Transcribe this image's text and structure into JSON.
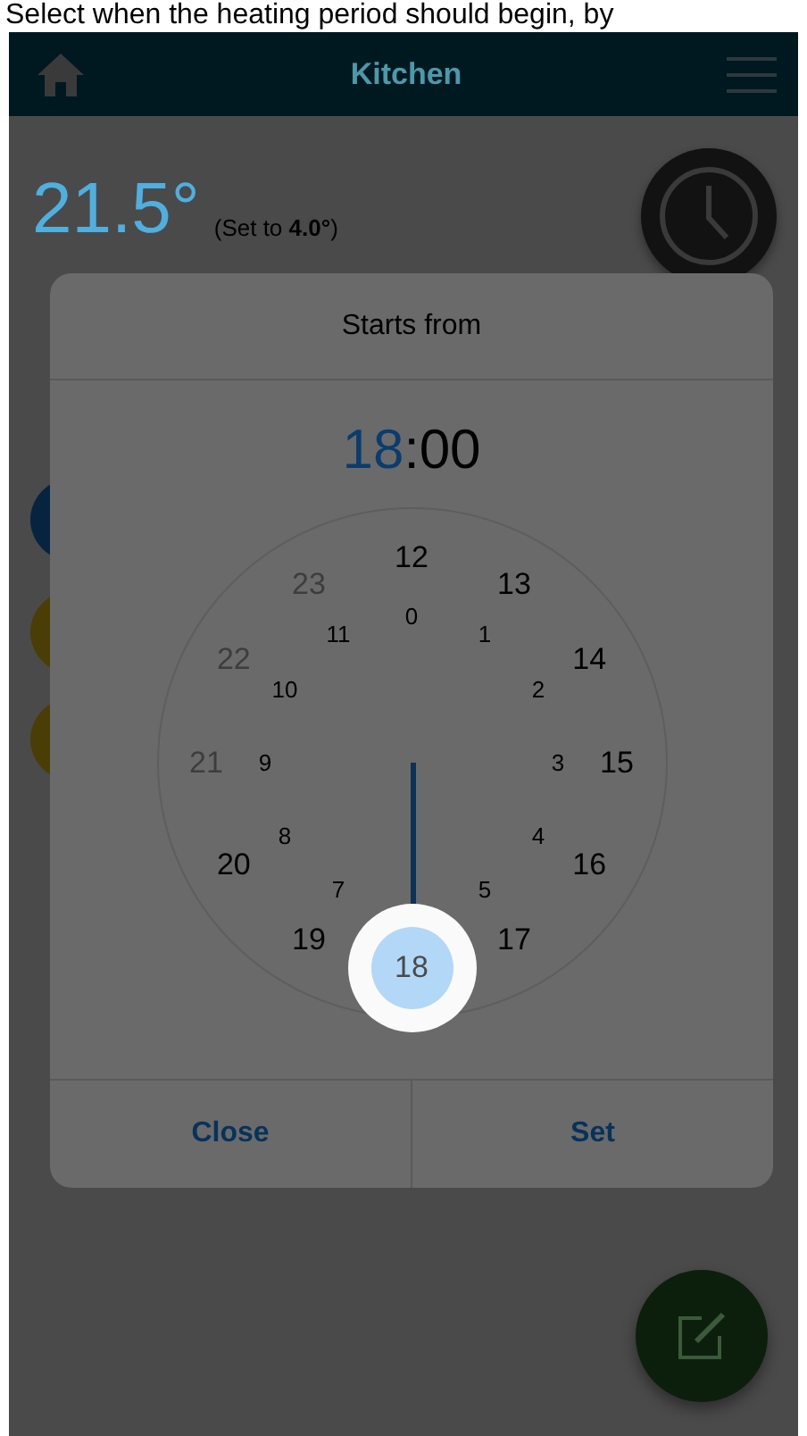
{
  "caption": "Select when the heating period should begin, by",
  "header": {
    "title": "Kitchen"
  },
  "room": {
    "temperature": "21.5°",
    "setpoint": "(Set to **4.0°**)"
  },
  "dialog": {
    "title": "Starts from",
    "time": {
      "hour": "18",
      "separator": ":",
      "minute": "00",
      "hour_selected": true
    },
    "outer_hours": [
      {
        "label": "12",
        "selected": false,
        "disabled": false
      },
      {
        "label": "13",
        "selected": false,
        "disabled": false
      },
      {
        "label": "14",
        "selected": false,
        "disabled": false
      },
      {
        "label": "15",
        "selected": false,
        "disabled": false
      },
      {
        "label": "16",
        "selected": false,
        "disabled": false
      },
      {
        "label": "17",
        "selected": false,
        "disabled": false
      },
      {
        "label": "18",
        "selected": true,
        "disabled": false
      },
      {
        "label": "19",
        "selected": false,
        "disabled": false
      },
      {
        "label": "20",
        "selected": false,
        "disabled": false
      },
      {
        "label": "21",
        "selected": false,
        "disabled": true
      },
      {
        "label": "22",
        "selected": false,
        "disabled": true
      },
      {
        "label": "23",
        "selected": false,
        "disabled": true
      }
    ],
    "inner_hours": [
      {
        "label": "0",
        "selected": false,
        "disabled": false
      },
      {
        "label": "1",
        "selected": false,
        "disabled": false
      },
      {
        "label": "2",
        "selected": false,
        "disabled": false
      },
      {
        "label": "3",
        "selected": false,
        "disabled": false
      },
      {
        "label": "4",
        "selected": false,
        "disabled": false
      },
      {
        "label": "5",
        "selected": false,
        "disabled": false
      },
      {
        "label": "7",
        "selected": false,
        "disabled": false
      },
      {
        "label": "8",
        "selected": false,
        "disabled": false
      },
      {
        "label": "9",
        "selected": false,
        "disabled": false
      },
      {
        "label": "10",
        "selected": false,
        "disabled": false
      },
      {
        "label": "11",
        "selected": false,
        "disabled": false
      }
    ],
    "buttons": [
      "Close",
      "Set"
    ]
  }
}
